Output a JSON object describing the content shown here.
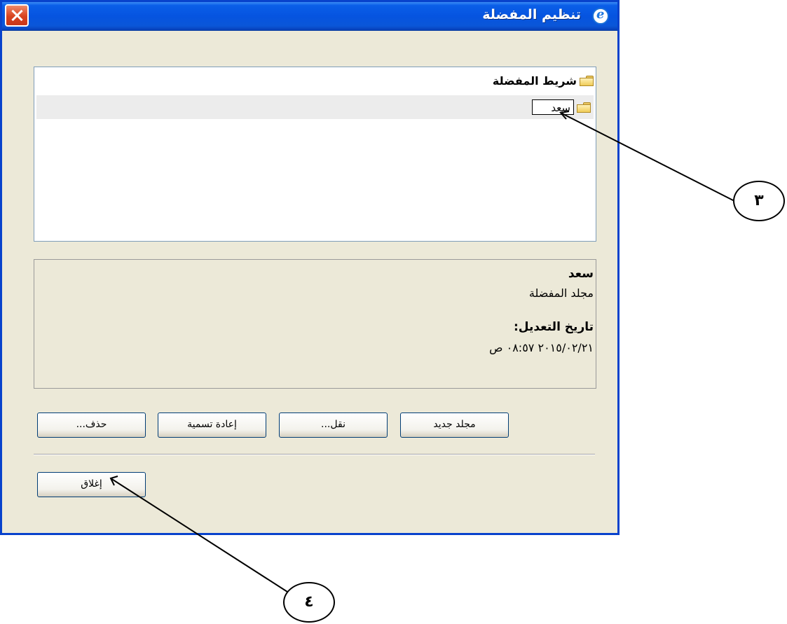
{
  "window": {
    "title": "تنظيم المفضلة"
  },
  "tree": {
    "root_label": "شريط المفضلة",
    "renaming_value": "سعد"
  },
  "details": {
    "name": "سعد",
    "type": "مجلد المفضلة",
    "modified_label": "تاريخ التعديل:",
    "modified_value": "٢٠١٥/٠٢/٢١ ٠٨:٥٧ ص"
  },
  "buttons": {
    "new_folder": "مجلد جديد",
    "move": "نقل...",
    "rename": "إعادة تسمية",
    "delete": "حذف...",
    "close": "إغلاق"
  },
  "annotations": {
    "callout_3": "٣",
    "callout_4": "٤"
  },
  "colors": {
    "titlebar": "#0654e0",
    "window_bg": "#ece9d8",
    "close_button": "#d8431f"
  }
}
